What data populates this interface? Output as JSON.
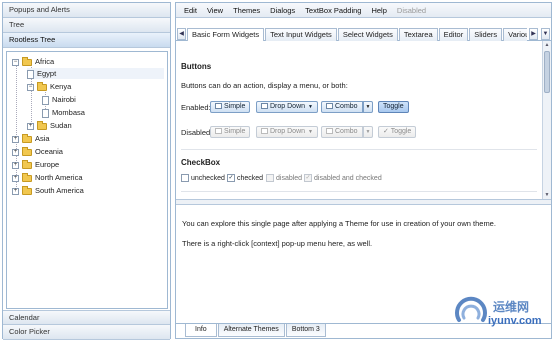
{
  "accordion": {
    "headers_top": [
      "Popups and Alerts",
      "Tree",
      "Rootless Tree"
    ],
    "headers_bottom": [
      "Calendar",
      "Color Picker"
    ]
  },
  "tree": {
    "nodes": [
      "Africa",
      "Egypt",
      "Kenya",
      "Nairobi",
      "Mombasa",
      "Sudan",
      "Asia",
      "Oceania",
      "Europe",
      "North America",
      "South America"
    ]
  },
  "menubar": {
    "items": [
      "Edit",
      "View",
      "Themes",
      "Dialogs",
      "TextBox Padding",
      "Help",
      "Disabled"
    ]
  },
  "tabs": [
    "Basic Form Widgets",
    "Text Input Widgets",
    "Select Widgets",
    "Textarea",
    "Editor",
    "Sliders",
    "Variou"
  ],
  "buttons_section": {
    "title": "Buttons",
    "desc": "Buttons can do an action, display a menu, or both:",
    "enabled_label": "Enabled:",
    "disabled_label": "Disabled:",
    "simple": "Simple",
    "dropdown": "Drop Down",
    "combo": "Combo",
    "toggle": "Toggle"
  },
  "checkbox_section": {
    "title": "CheckBox",
    "unchecked": "unchecked",
    "checked": "checked",
    "disabled": "disabled",
    "disabled_checked": "disabled and checked"
  },
  "bottom": {
    "line1": "You can explore this single page after applying a Theme for use in creation of your own theme.",
    "line2": "There is a right-click [context] pop-up menu here, as well.",
    "tabs": [
      "Info",
      "Alternate Themes",
      "Bottom 3"
    ]
  },
  "watermark": {
    "cn": "运维网",
    "url": "iyunv.com"
  }
}
